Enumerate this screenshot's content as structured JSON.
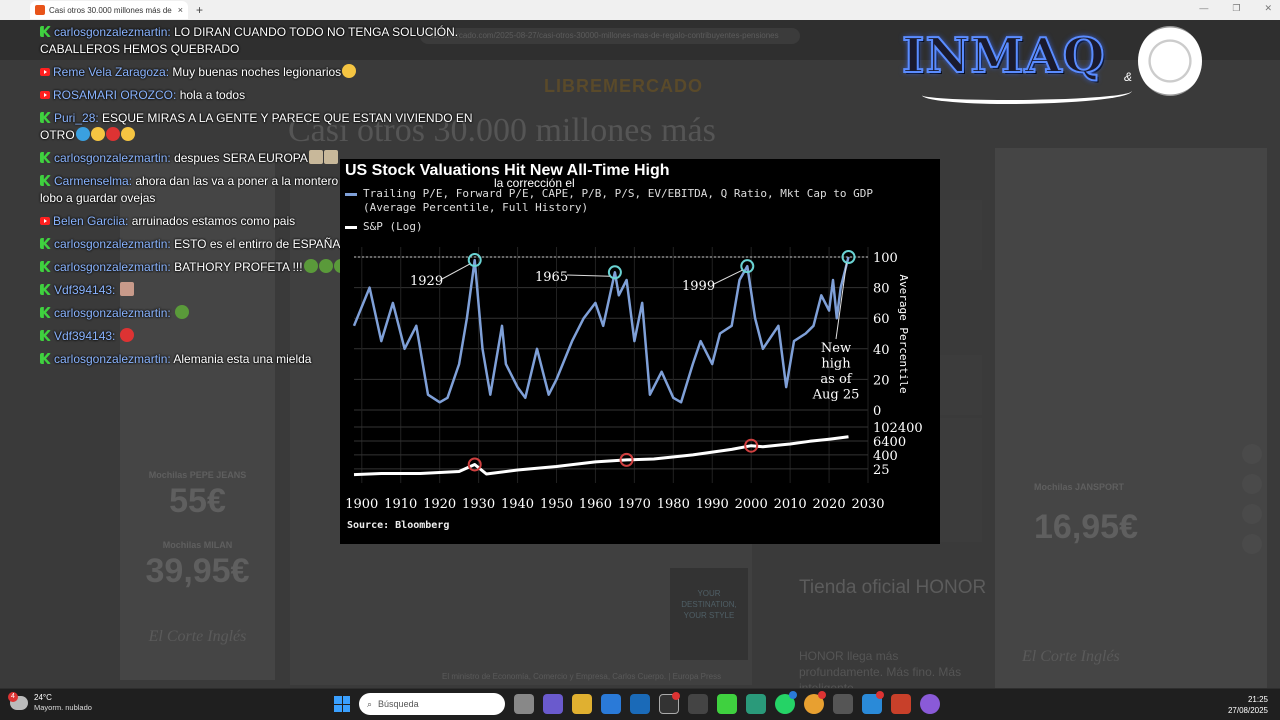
{
  "browser": {
    "tab_title": "Casi otros 30.000 millones más de",
    "tab_close": "×",
    "new_tab": "+",
    "win_min": "—",
    "win_max": "❐",
    "win_close": "✕",
    "address": "libremercado.com/2025-08-27/casi-otros-30000-millones-mas-de-regalo-contribuyentes-pensiones"
  },
  "webpage": {
    "site_logo": "LIBREMERCADO",
    "headline": "Casi otros 30.000 millones más",
    "left_ad": {
      "label1": "Mochilas PEPE JEANS",
      "price1": "55€",
      "label2": "Mochilas MILAN",
      "price2": "39,95€",
      "brand": "El Corte Inglés"
    },
    "right_ad": {
      "label": "Mochilas JANSPORT",
      "price": "16,95€",
      "brand": "El Corte Inglés"
    },
    "caption": "El ministro de Economía, Comercio y Empresa, Carlos Cuerpo. | Europa Press",
    "destino": "YOUR DESTINATION, YOUR STYLE",
    "tienda": "Tienda oficial HONOR",
    "honor": "HONOR llega más profundamente. Más fino. Más inteligente."
  },
  "chat": [
    {
      "platform": "kick",
      "user": "carlosgonzalezmartin:",
      "text": "LO DIRAN CUANDO TODO NO TENGA SOLUCIÓN. CABALLEROS HEMOS QUEBRADO",
      "emojis": []
    },
    {
      "platform": "youtube",
      "user": "Reme Vela Zaragoza:",
      "text": "Muy buenas noches legionarios",
      "emojis": [
        "#f5c542"
      ]
    },
    {
      "platform": "youtube",
      "user": "ROSAMARI OROZCO:",
      "text": "hola a todos",
      "emojis": []
    },
    {
      "platform": "kick",
      "user": "Puri_28:",
      "text": "ESQUE MIRAS A LA GENTE Y PARECE QUE ESTAN VIVIENDO EN OTRO",
      "emojis": [
        "#3aa0e0",
        "#f5c542",
        "#d33",
        "#f5c542"
      ]
    },
    {
      "platform": "kick",
      "user": "carlosgonzalezmartin:",
      "text": "despues SERA EUROPA",
      "emojis": [
        "#c8b89a",
        "#c8b89a"
      ]
    },
    {
      "platform": "kick",
      "user": "Carmenselma:",
      "text": "ahora dan las va a poner a la montero que vigile la corrección el lobo a guardar ovejas",
      "emojis": []
    },
    {
      "platform": "youtube",
      "user": "Belen Garciia:",
      "text": "arruinados estamos como pais",
      "emojis": []
    },
    {
      "platform": "kick",
      "user": "carlosgonzalezmartin:",
      "text": "ESTO es el entirro de ESPAÑA",
      "emojis": [
        "#c8b89a",
        "#c8b89a",
        "#c8b89a"
      ]
    },
    {
      "platform": "kick",
      "user": "carlosgonzalezmartin:",
      "text": "BATHORY PROFETA !!!",
      "emojis": [
        "#5a9a3a",
        "#5a9a3a",
        "#5a9a3a"
      ]
    },
    {
      "platform": "kick",
      "user": "Vdf394143:",
      "text": "",
      "emojis": [
        "#c89a8a"
      ]
    },
    {
      "platform": "kick",
      "user": "carlosgonzalezmartin:",
      "text": "",
      "emojis": [
        "#5a9a3a"
      ]
    },
    {
      "platform": "kick",
      "user": "Vdf394143:",
      "text": "",
      "emojis": [
        "#d33"
      ]
    },
    {
      "platform": "kick",
      "user": "carlosgonzalezmartin:",
      "text": "Alemania esta una mielda",
      "emojis": []
    }
  ],
  "logo": {
    "text": "INMAQ",
    "amp": "&"
  },
  "overlay_text": "la corrección el",
  "chart": {
    "title": "US Stock Valuations Hit New All-Time High",
    "legend_valuation_line1": "Trailing P/E, Forward P/E, CAPE, P/B, P/S, EV/EBITDA, Q Ratio, Mkt Cap to GDP",
    "legend_valuation_line2": "(Average Percentile, Full History)",
    "legend_sp": "S&P (Log)",
    "source": "Source: Bloomberg",
    "annotations": [
      "1929",
      "1965",
      "1999"
    ],
    "new_high": [
      "New",
      "high",
      "as of",
      "Aug 25"
    ],
    "y_title": "Average Percentile",
    "colors": {
      "valuation": "#7fa0d8",
      "sp": "#ffffff",
      "peak": "#6ad3d3",
      "sp_peak": "#d04040"
    }
  },
  "chart_data": [
    {
      "type": "line",
      "title": "US Stock Valuations Hit New All-Time High",
      "ylabel": "Average Percentile",
      "ylim": [
        0,
        100
      ],
      "yticks": [
        0,
        20,
        40,
        60,
        80,
        100
      ],
      "x": [
        1898,
        1902,
        1905,
        1908,
        1911,
        1914,
        1917,
        1920,
        1922,
        1925,
        1927,
        1929,
        1931,
        1933,
        1936,
        1937,
        1940,
        1942,
        1945,
        1948,
        1950,
        1954,
        1957,
        1960,
        1962,
        1965,
        1966,
        1968,
        1970,
        1972,
        1974,
        1977,
        1980,
        1982,
        1985,
        1987,
        1990,
        1992,
        1995,
        1997,
        1999,
        2001,
        2003,
        2007,
        2009,
        2011,
        2014,
        2016,
        2018,
        2020,
        2021,
        2022,
        2023,
        2025
      ],
      "series": [
        {
          "name": "Trailing P/E, Forward P/E, CAPE, P/B, P/S, EV/EBITDA, Q Ratio, Mkt Cap to GDP (Average Percentile, Full History)",
          "values": [
            55,
            80,
            45,
            70,
            40,
            55,
            10,
            5,
            8,
            30,
            60,
            98,
            40,
            10,
            55,
            30,
            15,
            8,
            40,
            10,
            20,
            45,
            60,
            70,
            55,
            90,
            75,
            85,
            45,
            70,
            10,
            25,
            8,
            5,
            30,
            45,
            30,
            50,
            55,
            85,
            94,
            60,
            40,
            55,
            15,
            45,
            50,
            55,
            75,
            65,
            85,
            60,
            80,
            100
          ]
        }
      ]
    },
    {
      "type": "line",
      "ylabel": "S&P (Log)",
      "yticks": [
        25,
        400,
        6400,
        102400
      ],
      "xticks": [
        1900,
        1910,
        1920,
        1930,
        1940,
        1950,
        1960,
        1970,
        1980,
        1990,
        2000,
        2010,
        2020,
        2030
      ],
      "x": [
        1898,
        1905,
        1915,
        1925,
        1929,
        1932,
        1940,
        1950,
        1960,
        1968,
        1975,
        1985,
        1995,
        2000,
        2003,
        2008,
        2010,
        2015,
        2020,
        2025
      ],
      "series": [
        {
          "name": "S&P (Log)",
          "values": [
            8,
            10,
            10,
            15,
            60,
            9,
            20,
            40,
            100,
            150,
            180,
            400,
            1200,
            2500,
            2000,
            3000,
            3500,
            6000,
            9000,
            15000
          ]
        }
      ]
    }
  ],
  "taskbar": {
    "temp": "24°C",
    "weather": "Mayorm. nublado",
    "weather_badge": "4",
    "search_placeholder": "Búsqueda",
    "time": "21:25",
    "date": "27/08/2025"
  }
}
